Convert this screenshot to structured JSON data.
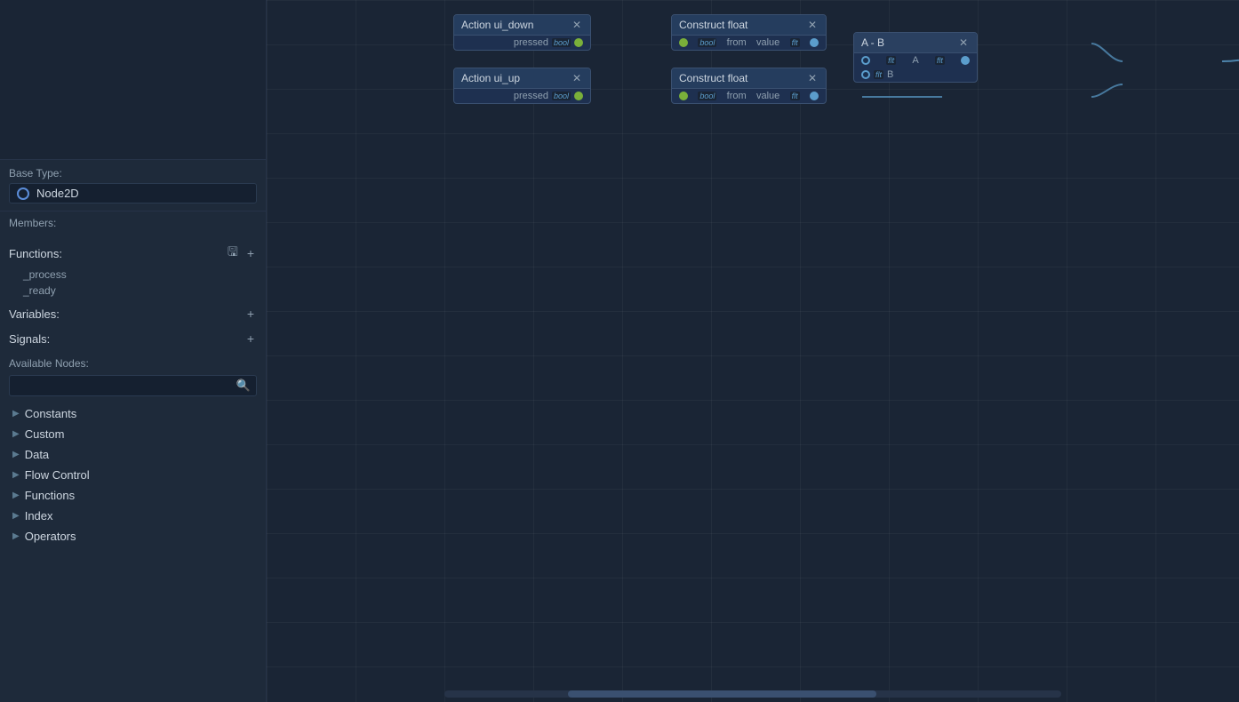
{
  "sidebar": {
    "base_type_label": "Base Type:",
    "base_type_value": "Node2D",
    "members_label": "Members:",
    "functions_label": "Functions:",
    "functions": [
      {
        "name": "_process"
      },
      {
        "name": "_ready"
      }
    ],
    "variables_label": "Variables:",
    "signals_label": "Signals:",
    "available_nodes_label": "Available Nodes:",
    "search_placeholder": "",
    "categories": [
      {
        "name": "Constants"
      },
      {
        "name": "Custom"
      },
      {
        "name": "Data"
      },
      {
        "name": "Flow Control"
      },
      {
        "name": "Functions"
      },
      {
        "name": "Index"
      },
      {
        "name": "Operators"
      }
    ]
  },
  "nodes": {
    "action_ui_down": {
      "title": "Action ui_down",
      "port_label": "pressed",
      "port_type": "bool"
    },
    "action_ui_up": {
      "title": "Action ui_up",
      "port_label": "pressed",
      "port_type": "bool"
    },
    "construct_float_1": {
      "title": "Construct float",
      "from_label": "from",
      "from_type": "bool",
      "value_label": "value",
      "value_type": "flt"
    },
    "construct_float_2": {
      "title": "Construct float",
      "from_label": "from",
      "from_type": "bool",
      "value_label": "value",
      "value_type": "flt"
    },
    "a_minus_b": {
      "title": "A - B",
      "a_type": "flt",
      "a_label": "A",
      "b_type": "flt",
      "b_label": "B",
      "out_type": "flt"
    }
  },
  "scrollbar": {
    "label": "horizontal-scrollbar"
  }
}
